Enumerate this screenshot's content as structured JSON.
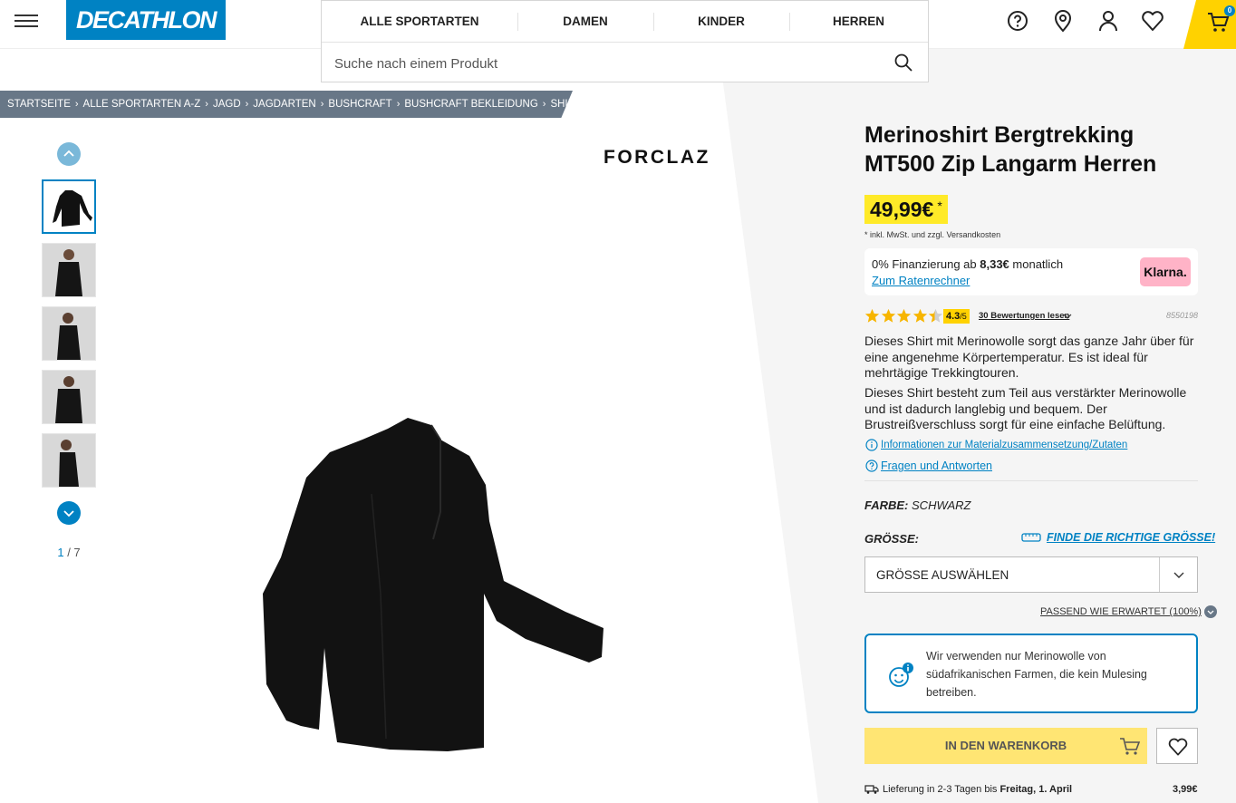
{
  "header": {
    "logo_text": "DECATHLON",
    "cart_count": "0",
    "brand_color": "#0082c3",
    "accent_color": "#ffd200"
  },
  "nav": {
    "tabs": [
      "ALLE SPORTARTEN",
      "DAMEN",
      "KINDER",
      "HERREN"
    ],
    "search_placeholder": "Suche nach einem Produkt"
  },
  "breadcrumb": [
    "STARTSEITE",
    "ALLE SPORTARTEN A-Z",
    "JAGD",
    "JAGDARTEN",
    "BUSHCRAFT",
    "BUSHCRAFT BEKLEIDUNG",
    "SHIRTS, T-SHIRTS"
  ],
  "gallery": {
    "brand": "FORCLAZ",
    "counter_current": "1",
    "counter_total": "/ 7"
  },
  "product": {
    "title": "Merinoshirt Bergtrekking MT500 Zip Langarm Herren",
    "price": "49,99€",
    "price_star": "*",
    "price_note": "* inkl. MwSt. und zzgl. Versandkosten",
    "klarna_text_prefix": "0% Finanzierung ab ",
    "klarna_amount": "8,33€",
    "klarna_text_suffix": " monatlich",
    "klarna_link": "Zum Ratenrechner",
    "klarna_logo": "Klarna.",
    "rating_value": "4.3",
    "rating_scale": "/5",
    "rating_stars": 4.3,
    "reviews_link": "30 Bewertungen lesen",
    "article_number": "8550198",
    "description_1": "Dieses Shirt mit Merinowolle sorgt das ganze Jahr über für eine angenehme Körpertemperatur. Es ist ideal für mehrtägige Trekkingtouren.",
    "description_2": "Dieses Shirt besteht zum Teil aus verstärkter Merinowolle und ist dadurch langlebig und bequem. Der Brustreißverschluss sorgt für eine einfache Belüftung.",
    "material_link": "Informationen zur Materialzusammensetzung/Zutaten",
    "faq_link": "Fragen und Antworten",
    "color_label": "FARBE:",
    "color_value": "SCHWARZ",
    "size_label": "GRÖSSE:",
    "size_guide": "FINDE DIE RICHTIGE GRÖSSE!",
    "size_select": "GRÖSSE AUSWÄHLEN",
    "fit_link": "PASSEND WIE ERWARTET (100%)",
    "info_card": "Wir verwenden nur Merinowolle von südafrikanischen Farmen, die kein Mulesing betreiben.",
    "add_to_cart": "IN DEN WARENKORB",
    "delivery_prefix": "Lieferung in 2-3 Tagen bis ",
    "delivery_date": "Freitag, 1. April",
    "delivery_price": "3,99€"
  }
}
